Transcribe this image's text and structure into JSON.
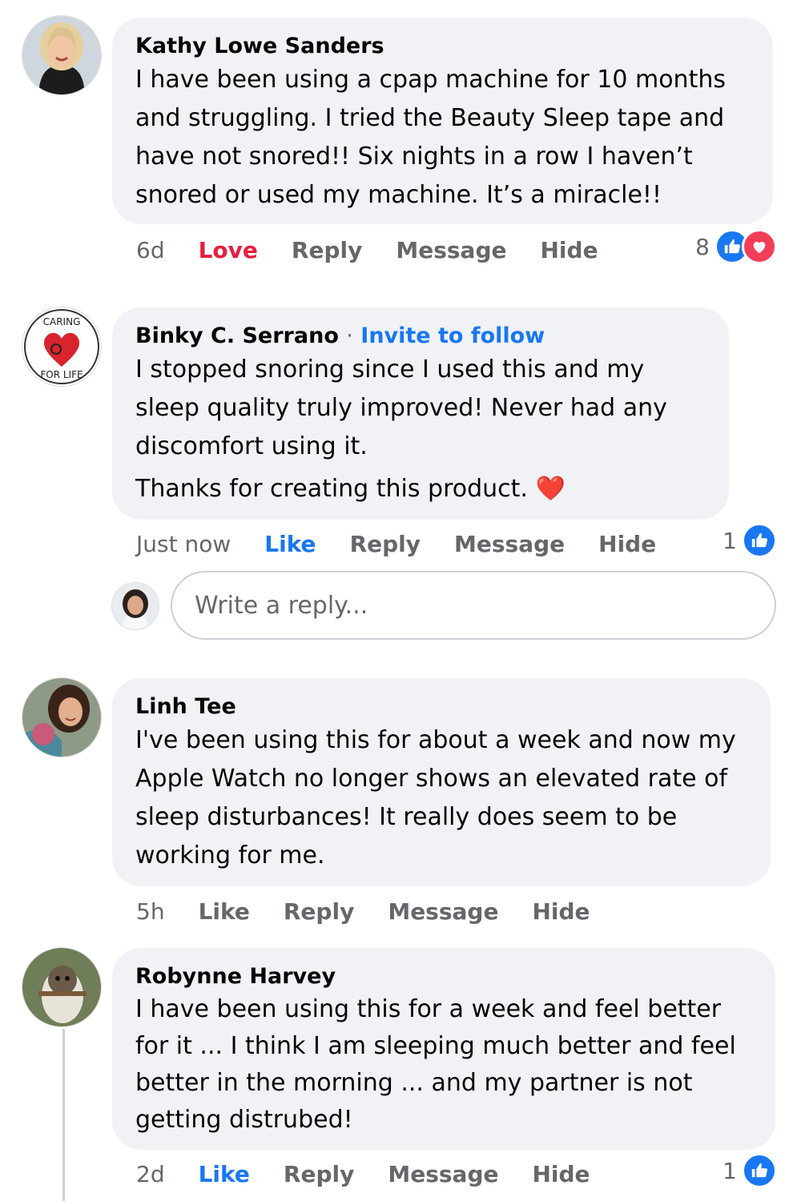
{
  "colors": {
    "bubble": "#f0f2f5",
    "secondary_text": "#65676b",
    "link_blue": "#1877f2",
    "love_red": "#e41e3f"
  },
  "comments": [
    {
      "author": "Kathy Lowe Sanders",
      "paragraphs": [
        "I have been using a cpap machine for 10 months and struggling. I tried the Beauty Sleep tape and have not snored!! Six nights in a row I haven’t snored or used my machine. It’s a miracle!!"
      ],
      "time": "6d",
      "reaction_label": "Love",
      "reply_label": "Reply",
      "message_label": "Message",
      "hide_label": "Hide",
      "reaction_count": "8",
      "reaction_icons": [
        "like-icon",
        "love-icon"
      ]
    },
    {
      "author": "Binky C. Serrano",
      "separator": "·",
      "invite": "Invite to follow",
      "avatar_text_top": "CARING",
      "avatar_text_bottom": "FOR LIFE",
      "paragraphs": [
        "I stopped snoring since I used this and my sleep quality truly improved! Never had any discomfort using it.",
        "Thanks for creating this product. ❤️"
      ],
      "time": "Just now",
      "reaction_label": "Like",
      "reply_label": "Reply",
      "message_label": "Message",
      "hide_label": "Hide",
      "reaction_count": "1",
      "reaction_icons": [
        "like-icon"
      ]
    },
    {
      "author": "Linh Tee",
      "paragraphs": [
        "I've been using this for about a week and now my Apple Watch no longer shows an elevated rate of sleep disturbances!  It really does seem to be working for me."
      ],
      "time": "5h",
      "reaction_label": "Like",
      "reply_label": "Reply",
      "message_label": "Message",
      "hide_label": "Hide"
    },
    {
      "author": "Robynne Harvey",
      "paragraphs": [
        "I have been using this for a week and feel better for it ... I think I am sleeping much better and feel better in the morning ... and my partner is not getting distrubed!"
      ],
      "time": "2d",
      "reaction_label": "Like",
      "reply_label": "Reply",
      "message_label": "Message",
      "hide_label": "Hide",
      "reaction_count": "1",
      "reaction_icons": [
        "like-icon"
      ]
    }
  ],
  "reply_box": {
    "placeholder": "Write a reply..."
  }
}
